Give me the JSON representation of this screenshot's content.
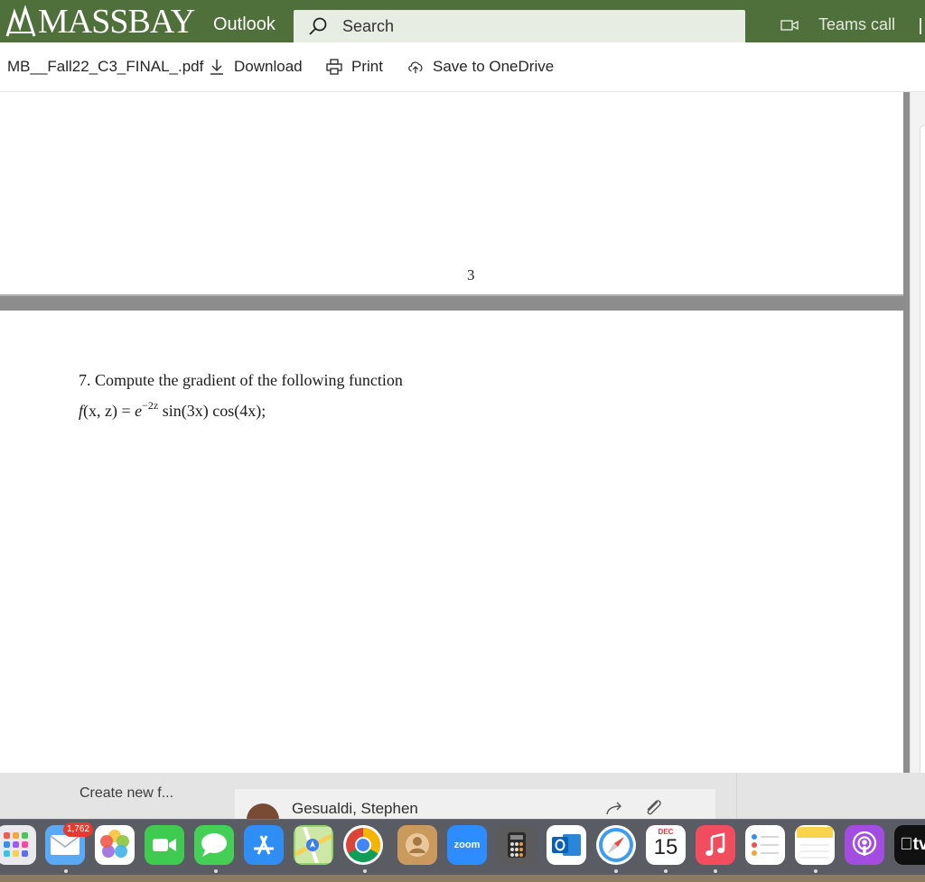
{
  "header": {
    "brand": "MASSBAY",
    "app": "Outlook",
    "search_placeholder": "Search",
    "teams_call": "Teams call",
    "colors": {
      "bar": "#4f6f3b",
      "search": "#e8ede3"
    }
  },
  "toolbar": {
    "filename": "MB__Fall22_C3_FINAL_.pdf",
    "download": "Download",
    "print": "Print",
    "save": "Save to OneDrive"
  },
  "document": {
    "page_number": "3",
    "question": "7. Compute the gradient of the following function",
    "formula": {
      "lhs_f": "f",
      "lhs_args": "(x, z) = ",
      "e": "e",
      "exp": "−2z",
      "rhs": " sin(3x) cos(4x);"
    }
  },
  "mail": {
    "create_new": "Create new f...",
    "sender": "Gesualdi, Stephen"
  },
  "dock": {
    "mail_badge": "1,762",
    "zoom_label": "zoom",
    "calendar_month": "DEC",
    "calendar_day": "15",
    "tv_label": "tv",
    "icons": [
      "launchpad-icon",
      "mail-icon",
      "photos-icon",
      "facetime-icon",
      "messages-icon",
      "app-store-icon",
      "maps-icon",
      "chrome-icon",
      "contacts-icon",
      "zoom-icon",
      "calculator-icon",
      "outlook-icon",
      "safari-icon",
      "calendar-icon",
      "music-icon",
      "reminders-icon",
      "notes-icon",
      "podcasts-icon",
      "apple-tv-icon"
    ]
  }
}
